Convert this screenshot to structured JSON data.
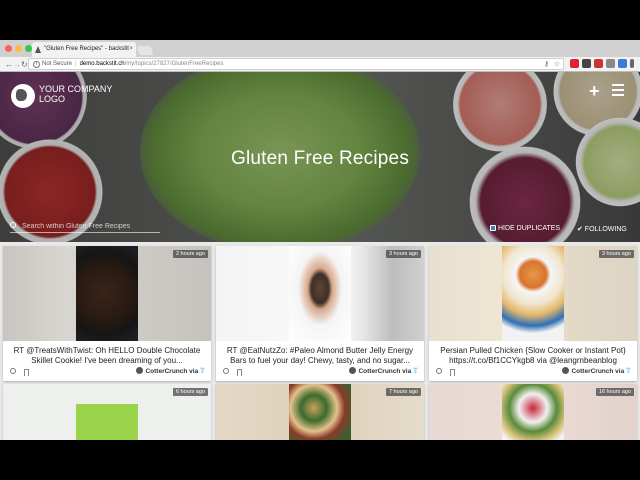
{
  "browser": {
    "tab_title": "\"Gluten Free Recipes\" - backstit",
    "tab_close": "×",
    "url_security": "Not Secure",
    "url_host": "demo.backstit.ch",
    "url_path": "/my/topics/27827/GlutenFreeRecipes",
    "back": "←",
    "forward": "→",
    "reload": "↻",
    "key_icon": "⚷",
    "star_icon": "☆"
  },
  "hero": {
    "title": "Gluten Free Recipes",
    "logo_line1": "YOUR COMPANY",
    "logo_line2": "LOGO",
    "add_icon": "+",
    "search_placeholder": "Search within Gluten Free Recipes",
    "hide_duplicates": "HIDE DUPLICATES",
    "following": "✔ FOLLOWING"
  },
  "cards": [
    {
      "time": "2 hours ago",
      "text": "RT @TreatsWithTwist: Oh HELLO Double Chocolate Skillet Cookie! I've been dreaming of you...",
      "author": "CotterCrunch",
      "via": "via",
      "bird": "🐦"
    },
    {
      "time": "3 hours ago",
      "text": "RT @EatNutzZo: #Paleo Almond Butter Jelly Energy Bars to fuel your day! Chewy, tasty, and no sugar...",
      "author": "CotterCrunch",
      "via": "via",
      "bird": "🐦"
    },
    {
      "time": "3 hours ago",
      "text": "Persian Pulled Chicken {Slow Cooker or Instant Pot} https://t.co/Bf1CCYkgb8 via @leangrnbeanblog",
      "author": "CotterCrunch",
      "via": "via",
      "bird": "🐦"
    },
    {
      "time": "6 hours ago"
    },
    {
      "time": "7 hours ago"
    },
    {
      "time": "16 hours ago"
    }
  ],
  "colors": {
    "twitter": "#1da1f2",
    "checkbox": "#3b82c4"
  }
}
